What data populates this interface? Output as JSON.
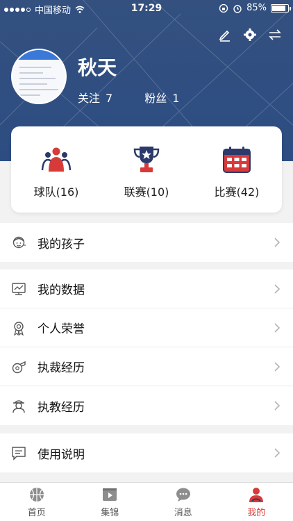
{
  "status_bar": {
    "carrier": "中国移动",
    "time": "17:29",
    "battery": "85%",
    "battery_level": 0.85
  },
  "profile": {
    "name": "秋天",
    "following_label": "关注",
    "following_count": "7",
    "fans_label": "粉丝",
    "fans_count": "1"
  },
  "summary": [
    {
      "label": "球队(16)",
      "icon": "team-icon"
    },
    {
      "label": "联赛(10)",
      "icon": "trophy-icon"
    },
    {
      "label": "比赛(42)",
      "icon": "calendar-icon"
    }
  ],
  "menu_groups": [
    [
      {
        "label": "我的孩子",
        "icon": "child-icon"
      }
    ],
    [
      {
        "label": "我的数据",
        "icon": "data-monitor-icon"
      },
      {
        "label": "个人荣誉",
        "icon": "medal-icon"
      },
      {
        "label": "执裁经历",
        "icon": "whistle-icon"
      },
      {
        "label": "执教经历",
        "icon": "coach-icon"
      }
    ],
    [
      {
        "label": "使用说明",
        "icon": "message-icon"
      }
    ]
  ],
  "tabs": [
    {
      "label": "首页",
      "icon": "basketball-icon"
    },
    {
      "label": "集锦",
      "icon": "video-icon"
    },
    {
      "label": "消息",
      "icon": "chat-icon"
    },
    {
      "label": "我的",
      "icon": "user-icon",
      "active": true
    }
  ],
  "colors": {
    "header_bg": "#2d4d82",
    "accent_red": "#d83a3a",
    "navy": "#2b3a6b"
  }
}
